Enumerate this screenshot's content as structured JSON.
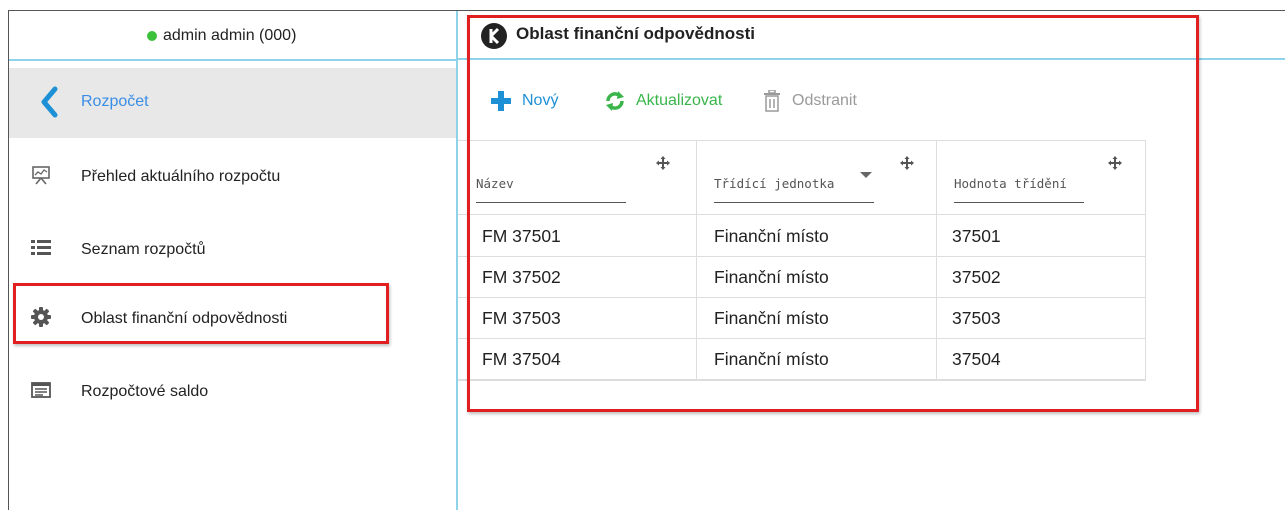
{
  "user": {
    "label": "admin admin (000)",
    "status_color": "#3cc13c"
  },
  "sidebar": {
    "back_label": "Rozpočet",
    "items": [
      {
        "label": "Přehled aktuálního rozpočtu",
        "icon": "presentation-chart-icon"
      },
      {
        "label": "Seznam rozpočtů",
        "icon": "list-icon"
      },
      {
        "label": "Oblast finanční odpovědnosti",
        "icon": "gear-icon"
      },
      {
        "label": "Rozpočtové saldo",
        "icon": "table-card-icon"
      }
    ]
  },
  "main": {
    "title": "Oblast finanční odpovědnosti",
    "toolbar": {
      "new_label": "Nový",
      "refresh_label": "Aktualizovat",
      "delete_label": "Odstranit"
    },
    "table": {
      "columns": [
        "Název",
        "Třídící jednotka",
        "Hodnota třídění"
      ],
      "rows": [
        [
          "FM 37501",
          "Finanční místo",
          "37501"
        ],
        [
          "FM 37502",
          "Finanční místo",
          "37502"
        ],
        [
          "FM 37503",
          "Finanční místo",
          "37503"
        ],
        [
          "FM 37504",
          "Finanční místo",
          "37504"
        ]
      ]
    }
  },
  "colors": {
    "accent_blue": "#1e90d6",
    "accent_green": "#39b54a",
    "highlight_red": "#e02020",
    "divider": "#8fd3ea"
  }
}
